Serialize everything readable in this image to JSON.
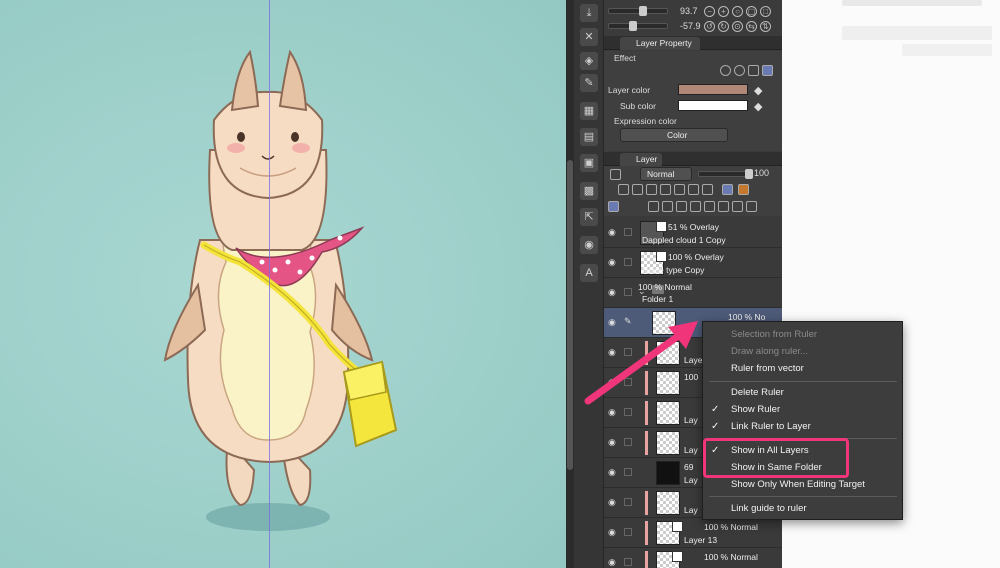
{
  "panel": {
    "top_controls": {
      "value_a": "93.7",
      "value_b": "-57.9"
    },
    "layer_property": {
      "tab_label": "Layer Property",
      "effect_label": "Effect",
      "layer_color_label": "Layer color",
      "layer_color": "#b08878",
      "sub_color_label": "Sub color",
      "sub_color": "#ffffff",
      "expression_color_label": "Expression color",
      "expression_color_value": "Color"
    },
    "layer_tab": {
      "tab_label": "Layer",
      "blend_mode": "Normal",
      "opacity": "100"
    },
    "layers": [
      {
        "line1": "51 % Overlay",
        "line2": "Dappled cloud 1 Copy"
      },
      {
        "line1": "100 % Overlay",
        "line2": "Noise type Copy"
      },
      {
        "line1": "100 % Normal",
        "line2": "Folder 1"
      },
      {
        "line1": "100 % No",
        "line2": ""
      },
      {
        "line1": "",
        "line2": "Laye"
      },
      {
        "line1": "100",
        "line2": ""
      },
      {
        "line1": "",
        "line2": "Lay"
      },
      {
        "line1": "",
        "line2": "Lay"
      },
      {
        "line1": "69",
        "line2": "Lay"
      },
      {
        "line1": "",
        "line2": "Lay"
      },
      {
        "line1": "100 % Normal",
        "line2": "Layer 13"
      },
      {
        "line1": "100 % Normal",
        "line2": ""
      }
    ]
  },
  "context_menu": {
    "items": [
      {
        "label": "Selection from Ruler",
        "enabled": false,
        "checked": false
      },
      {
        "label": "Draw along ruler...",
        "enabled": false,
        "checked": false
      },
      {
        "label": "Ruler from vector",
        "enabled": true,
        "checked": false
      },
      {
        "label": "Delete Ruler",
        "enabled": true,
        "checked": false
      },
      {
        "label": "Show Ruler",
        "enabled": true,
        "checked": true
      },
      {
        "label": "Link Ruler to Layer",
        "enabled": true,
        "checked": true
      },
      {
        "label": "Show in All Layers",
        "enabled": true,
        "checked": true
      },
      {
        "label": "Show in Same Folder",
        "enabled": true,
        "checked": false
      },
      {
        "label": "Show Only When Editing Target",
        "enabled": true,
        "checked": false
      },
      {
        "label": "Link guide to ruler",
        "enabled": true,
        "checked": false
      }
    ],
    "check_glyph": "✓"
  },
  "colors": {
    "highlight": "#f0357a",
    "arrow": "#f0357a",
    "canvas": "#9fd0ca",
    "panel": "#3b3b3b"
  }
}
